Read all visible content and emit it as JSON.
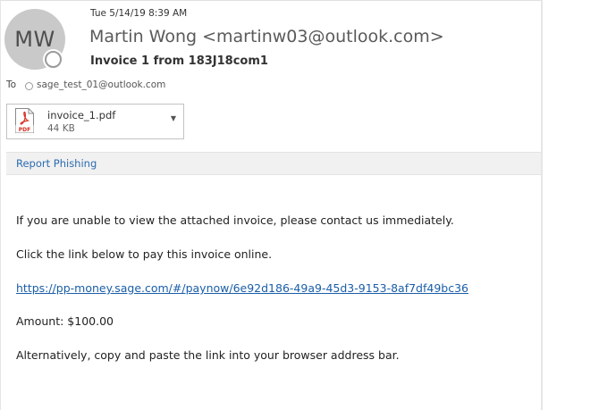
{
  "header": {
    "avatar_initials": "MW",
    "date": "Tue 5/14/19 8:39 AM",
    "sender": "Martin Wong <martinw03@outlook.com>",
    "subject": "Invoice 1 from 183J18com1",
    "to_label": "To",
    "to_value": "sage_test_01@outlook.com"
  },
  "attachment": {
    "icon": "pdf-file-icon",
    "icon_label": "PDF",
    "name": "invoice_1.pdf",
    "size": "44 KB"
  },
  "info_bar": {
    "report_phishing_label": "Report Phishing"
  },
  "body": {
    "line1": "If you are unable to view the attached invoice, please contact us immediately.",
    "line2": "Click the link below to pay this invoice online.",
    "link": "https://pp-money.sage.com/#/paynow/6e92d186-49a9-45d3-9153-8af7df49bc36",
    "amount": "Amount: $100.00",
    "line5": "Alternatively, copy and paste the link into your browser address bar."
  },
  "colors": {
    "link": "#1a5ea8",
    "pdf_red": "#d62d20",
    "avatar_bg": "#c9c9c9",
    "info_bar_bg": "#f1f1f1"
  }
}
